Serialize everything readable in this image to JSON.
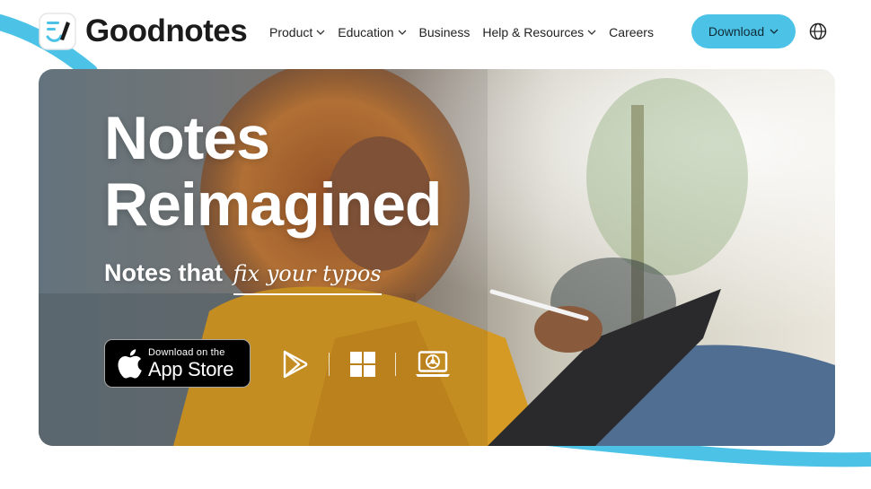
{
  "brand": {
    "name": "Goodnotes",
    "accent": "#4cc3e6"
  },
  "nav": {
    "items": [
      {
        "label": "Product",
        "has_dropdown": true
      },
      {
        "label": "Education",
        "has_dropdown": true
      },
      {
        "label": "Business",
        "has_dropdown": false
      },
      {
        "label": "Help & Resources",
        "has_dropdown": true
      },
      {
        "label": "Careers",
        "has_dropdown": false
      }
    ],
    "download_label": "Download",
    "language_icon": "globe-icon"
  },
  "hero": {
    "title_line1": "Notes",
    "title_line2": "Reimagined",
    "subtitle_prefix": "Notes that",
    "subtitle_script": "fix your typos",
    "app_store": {
      "small": "Download on the",
      "big": "App Store"
    },
    "platform_icons": [
      "google-play-icon",
      "windows-icon",
      "web-browser-icon"
    ]
  }
}
